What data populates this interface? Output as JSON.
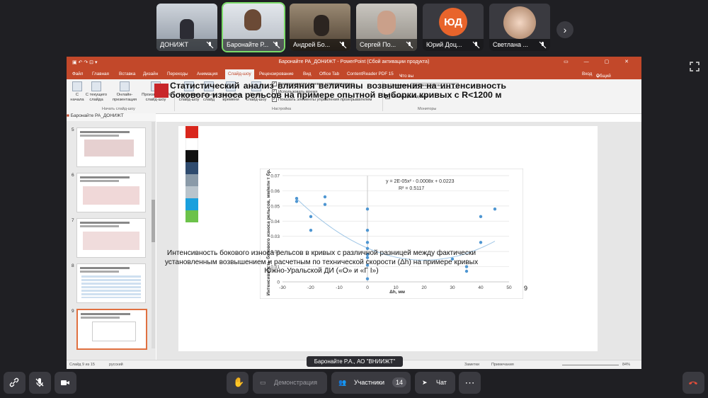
{
  "participants": [
    {
      "name": "ДОНИЖТ",
      "muted": true
    },
    {
      "name": "Баронайте Р...",
      "muted": true,
      "active": true
    },
    {
      "name": "Андрей Бо...",
      "muted": true
    },
    {
      "name": "Сергей По...",
      "muted": true
    },
    {
      "name": "Юрий Доц...",
      "muted": true,
      "initials": "ЮД",
      "avatar_color": "#e8642b"
    },
    {
      "name": "Светлана ...",
      "muted": true
    }
  ],
  "ppt": {
    "window_title": "Баронайте РА_ДОНИЖТ - PowerPoint (Сбой активации продукта)",
    "tabs": [
      "Файл",
      "Главная",
      "Вставка",
      "Дизайн",
      "Переходы",
      "Анимация",
      "Слайд-шоу",
      "Рецензирование",
      "Вид",
      "Office Tab",
      "ContentReader PDF 15"
    ],
    "selected_tab": "Слайд-шоу",
    "tell_me": "Что вы хотите сделать?",
    "login": "Вход",
    "share": "Общий доступ",
    "ribbon": {
      "from_start": "С начала",
      "from_current": "С текущего слайда",
      "online": "Онлайн-презентация",
      "custom": "Произвольный слайд-шоу",
      "group_start": "Начать слайд-шоу",
      "setup": "Настройка слайд-шоу",
      "hide": "Скрыть слайд",
      "rehearse": "Настройка времени",
      "record": "Запись слайд-шоу",
      "opt1": "Воспроизвести речевое сопровождение",
      "opt2": "Использовать время",
      "opt3": "Показать элементы управления проигрывателем",
      "group_setup": "Настройка",
      "monitor_label": "Монитор:",
      "monitor_value": "Автоматически",
      "presenter": "Режим докладчика",
      "group_monitors": "Мониторы"
    },
    "file_tab": "Баронайте РА_ДОНИЖТ",
    "thumb_numbers": [
      "5",
      "6",
      "7",
      "8",
      "9"
    ],
    "status": {
      "slide": "Слайд 9 из 15",
      "lang": "русский",
      "notes": "Заметки",
      "comments": "Примечания",
      "zoom": "84%"
    }
  },
  "slide": {
    "title": "Статистический анализ влияния величины возвышения на интенсивность бокового износа рельсов на примере опытной выборки кривых с R<1200 м",
    "caption": "Интенсивность бокового износа рельсов в кривых с различной разницей между фактически установленным возвышением и расчетным по технической скорости (Δh) на примере кривых Южно-Уральской ДИ («О» и «Г I»)",
    "page": "9",
    "color_bars": [
      "#d9261c",
      "#ffffff",
      "#111111",
      "#2f4b6e",
      "#8a9aa8",
      "#b9c4cc",
      "#1aa0dd",
      "#6cc24a"
    ]
  },
  "chart_data": {
    "type": "scatter",
    "xlabel": "Δh, мм",
    "ylabel": "Интенсивность бокового износа рельсов, мм/млн т бр.",
    "xlim": [
      -30,
      50
    ],
    "ylim": [
      0,
      0.07
    ],
    "xticks": [
      -30,
      -20,
      -10,
      0,
      10,
      20,
      30,
      40,
      50
    ],
    "yticks": [
      0,
      0.01,
      0.02,
      0.03,
      0.04,
      0.05,
      0.06,
      0.07
    ],
    "points": [
      [
        -25,
        0.055
      ],
      [
        -25,
        0.053
      ],
      [
        -20,
        0.043
      ],
      [
        -20,
        0.034
      ],
      [
        -15,
        0.056
      ],
      [
        -15,
        0.051
      ],
      [
        0,
        0.048
      ],
      [
        0,
        0.034
      ],
      [
        0,
        0.026
      ],
      [
        0,
        0.022
      ],
      [
        0,
        0.018
      ],
      [
        0,
        0.016
      ],
      [
        0,
        0.011
      ],
      [
        0,
        0.002
      ],
      [
        30,
        0.015
      ],
      [
        35,
        0.01
      ],
      [
        35,
        0.007
      ],
      [
        40,
        0.043
      ],
      [
        40,
        0.026
      ],
      [
        45,
        0.048
      ]
    ],
    "trend": {
      "equation": "y = 2E-05x² - 0.0008x + 0.0223",
      "r2": "R² = 0.5117",
      "a": 2e-05,
      "b": -0.0008,
      "c": 0.0223
    },
    "point_color": "#4e96d2",
    "grid": true
  },
  "presenter_label": "Баронайте Р.А., АО \"ВНИИЖТ\"",
  "toolbar": {
    "demo": "Демонстрация",
    "participants": "Участники",
    "participants_count": "14",
    "chat": "Чат",
    "more": "⋯"
  }
}
